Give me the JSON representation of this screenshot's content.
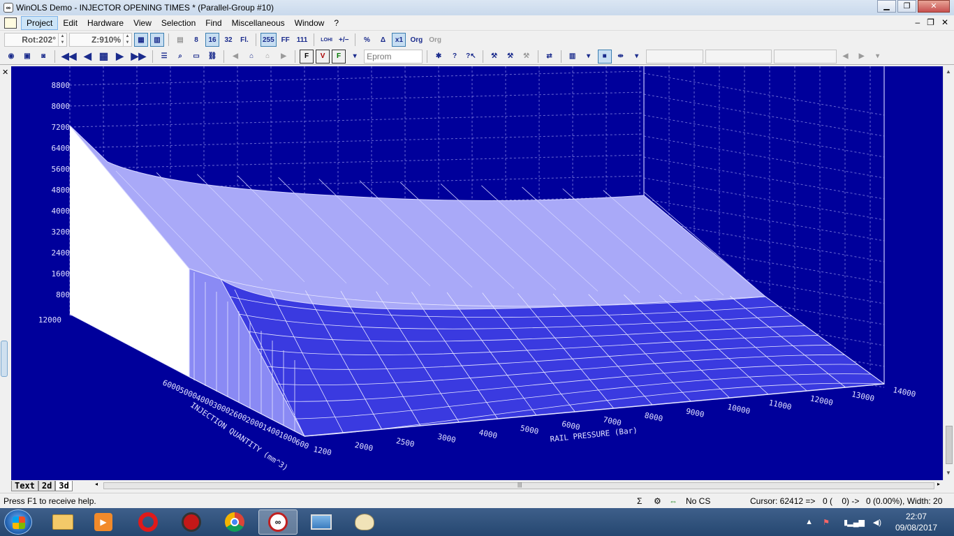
{
  "window": {
    "title": "WinOLS Demo - INJECTOR OPENING TIMES * (Parallel-Group #10)",
    "app_icon": "winols-icon"
  },
  "menu": {
    "items": [
      "Project",
      "Edit",
      "Hardware",
      "View",
      "Selection",
      "Find",
      "Miscellaneous",
      "Window",
      "?"
    ],
    "active": "Project"
  },
  "toolbar": {
    "rotation": "Rot:202°",
    "zoom": "Z:910%",
    "btn_8": "8",
    "btn_16": "16",
    "btn_32": "32",
    "btn_fl": "Fl.",
    "btn_255": "255",
    "btn_ff": "FF",
    "btn_111": "111",
    "btn_lohi": "LOHI",
    "btn_percent": "%",
    "btn_delta": "Δ",
    "btn_x1": "x1",
    "btn_org": "Org",
    "btn_org2": "Org",
    "eprom_combo": "Eprom"
  },
  "chart_data": {
    "type": "surface-3d",
    "z_ticks": [
      "800",
      "1600",
      "2400",
      "3200",
      "4000",
      "4800",
      "5600",
      "6400",
      "7200",
      "8000",
      "8800"
    ],
    "z_ticks_front": [
      "12000"
    ],
    "x_axis_label": "RAIL PRESSURE (Bar)",
    "x_ticks": [
      "1200",
      "2000",
      "2500",
      "3000",
      "4000",
      "5000",
      "6000",
      "7000",
      "8000",
      "9000",
      "10000",
      "11000",
      "12000",
      "13000",
      "14000"
    ],
    "y_axis_label": "INJECTION QUANTITY (mm^3)",
    "y_ticks": [
      "6000",
      "5000",
      "4000",
      "3000",
      "2600",
      "2000",
      "1400",
      "1000",
      "600"
    ],
    "z_max_value": 7200,
    "surface_color": "#9b9bff",
    "background_color": "#00009b",
    "grid": true
  },
  "tabs": [
    "Text",
    "2d",
    "3d"
  ],
  "active_tab": "3d",
  "status": {
    "help": "Press F1 to receive help.",
    "checksum": "No CS",
    "cursor": "Cursor: 62412 =>",
    "values": "0 (    0) ->",
    "width": "0 (0.00%), Width: 20"
  },
  "taskbar": {
    "time": "22:07",
    "date": "09/08/2017"
  }
}
